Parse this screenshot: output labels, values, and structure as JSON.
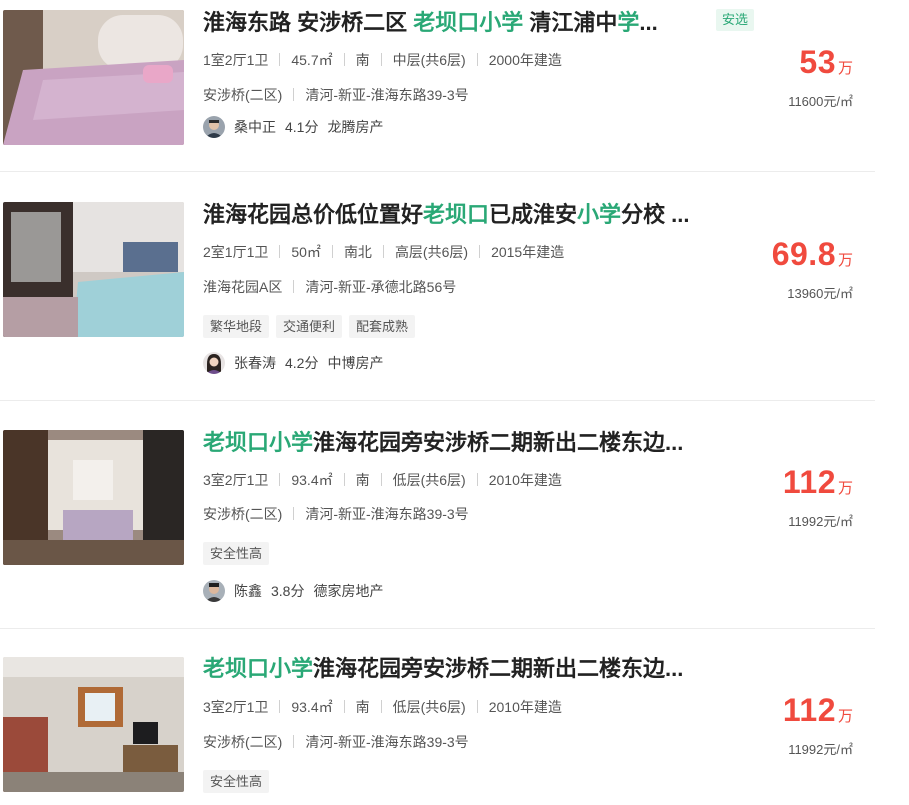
{
  "listings": [
    {
      "title_parts": [
        "淮海东路 安涉桥二区 ",
        "老坝口小学",
        " 清江浦中",
        "学",
        "..."
      ],
      "badge": "安选",
      "layout": "1室2厅1卫",
      "area": "45.7㎡",
      "orientation": "南",
      "floor": "中层(共6层)",
      "year": "2000年建造",
      "community": "安涉桥(二区)",
      "address": "清河-新亚-淮海东路39-3号",
      "tags": [],
      "agent": {
        "name": "桑中正",
        "score": "4.1分",
        "company": "龙腾房产"
      },
      "price": "53",
      "price_unit": "万",
      "unit_price": "11600元/㎡"
    },
    {
      "title_parts": [
        "淮海花园总价低位置好",
        "老坝口",
        "已成淮安",
        "小学",
        "分校 ..."
      ],
      "layout": "2室1厅1卫",
      "area": "50㎡",
      "orientation": "南北",
      "floor": "高层(共6层)",
      "year": "2015年建造",
      "community": "淮海花园A区",
      "address": "清河-新亚-承德北路56号",
      "tags": [
        "繁华地段",
        "交通便利",
        "配套成熟"
      ],
      "agent": {
        "name": "张春涛",
        "score": "4.2分",
        "company": "中博房产"
      },
      "price": "69.8",
      "price_unit": "万",
      "unit_price": "13960元/㎡"
    },
    {
      "title_parts": [
        "",
        "老坝口小学",
        "淮海花园旁安涉桥二期新出二楼东边..."
      ],
      "layout": "3室2厅1卫",
      "area": "93.4㎡",
      "orientation": "南",
      "floor": "低层(共6层)",
      "year": "2010年建造",
      "community": "安涉桥(二区)",
      "address": "清河-新亚-淮海东路39-3号",
      "tags": [
        "安全性高"
      ],
      "agent": {
        "name": "陈鑫",
        "score": "3.8分",
        "company": "德家房地产"
      },
      "price": "112",
      "price_unit": "万",
      "unit_price": "11992元/㎡"
    },
    {
      "title_parts": [
        "",
        "老坝口小学",
        "淮海花园旁安涉桥二期新出二楼东边..."
      ],
      "layout": "3室2厅1卫",
      "area": "93.4㎡",
      "orientation": "南",
      "floor": "低层(共6层)",
      "year": "2010年建造",
      "community": "安涉桥(二区)",
      "address": "清河-新亚-淮海东路39-3号",
      "tags": [
        "安全性高"
      ],
      "price": "112",
      "price_unit": "万",
      "unit_price": "11992元/㎡"
    }
  ],
  "colors": {
    "accent": "#2aa876",
    "price": "#f04a3e"
  }
}
